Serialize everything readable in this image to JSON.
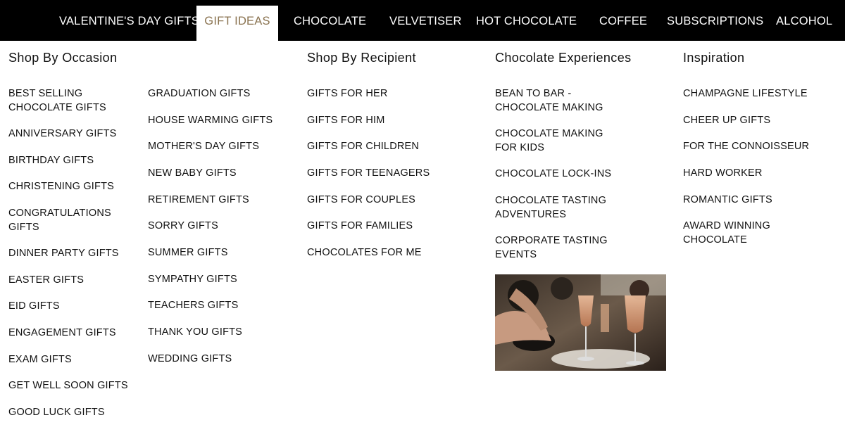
{
  "nav": {
    "items": [
      {
        "label": "VALENTINE'S DAY GIFTS"
      },
      {
        "label": "GIFT IDEAS"
      },
      {
        "label": "CHOCOLATE"
      },
      {
        "label": "VELVETISER"
      },
      {
        "label": "HOT CHOCOLATE"
      },
      {
        "label": "COFFEE"
      },
      {
        "label": "SUBSCRIPTIONS"
      },
      {
        "label": "ALCOHOL"
      }
    ],
    "active": "GIFT IDEAS"
  },
  "menu": {
    "occasion": {
      "heading": "Shop By Occasion",
      "col1": [
        "BEST SELLING CHOCOLATE GIFTS",
        "ANNIVERSARY GIFTS",
        "BIRTHDAY GIFTS",
        "CHRISTENING GIFTS",
        "CONGRATULATIONS GIFTS",
        "DINNER PARTY GIFTS",
        "EASTER GIFTS",
        "EID GIFTS",
        "ENGAGEMENT GIFTS",
        "EXAM GIFTS",
        "GET WELL SOON GIFTS",
        "GOOD LUCK GIFTS"
      ],
      "col2": [
        "GRADUATION GIFTS",
        "HOUSE WARMING GIFTS",
        "MOTHER'S DAY GIFTS",
        "NEW BABY GIFTS",
        "RETIREMENT GIFTS",
        "SORRY GIFTS",
        "SUMMER GIFTS",
        "SYMPATHY GIFTS",
        "TEACHERS GIFTS",
        "THANK YOU GIFTS",
        "WEDDING GIFTS"
      ]
    },
    "recipient": {
      "heading": "Shop By Recipient",
      "items": [
        "GIFTS FOR HER",
        "GIFTS FOR HIM",
        "GIFTS FOR CHILDREN",
        "GIFTS FOR TEENAGERS",
        "GIFTS FOR COUPLES",
        "GIFTS FOR FAMILIES",
        "CHOCOLATES FOR ME"
      ]
    },
    "experiences": {
      "heading": "Chocolate Experiences",
      "items": [
        "BEAN TO BAR - CHOCOLATE MAKING",
        "CHOCOLATE MAKING FOR KIDS",
        "CHOCOLATE LOCK-INS",
        "CHOCOLATE TASTING ADVENTURES",
        "CORPORATE TASTING EVENTS"
      ]
    },
    "inspiration": {
      "heading": "Inspiration",
      "items": [
        "CHAMPAGNE LIFESTYLE",
        "CHEER UP GIFTS",
        "FOR THE CONNOISSEUR",
        "HARD WORKER",
        "ROMANTIC GIFTS",
        "AWARD WINNING CHOCOLATE"
      ]
    }
  },
  "colors": {
    "nav_bg": "#000000",
    "active_text": "#8a7350",
    "text": "#111111"
  }
}
